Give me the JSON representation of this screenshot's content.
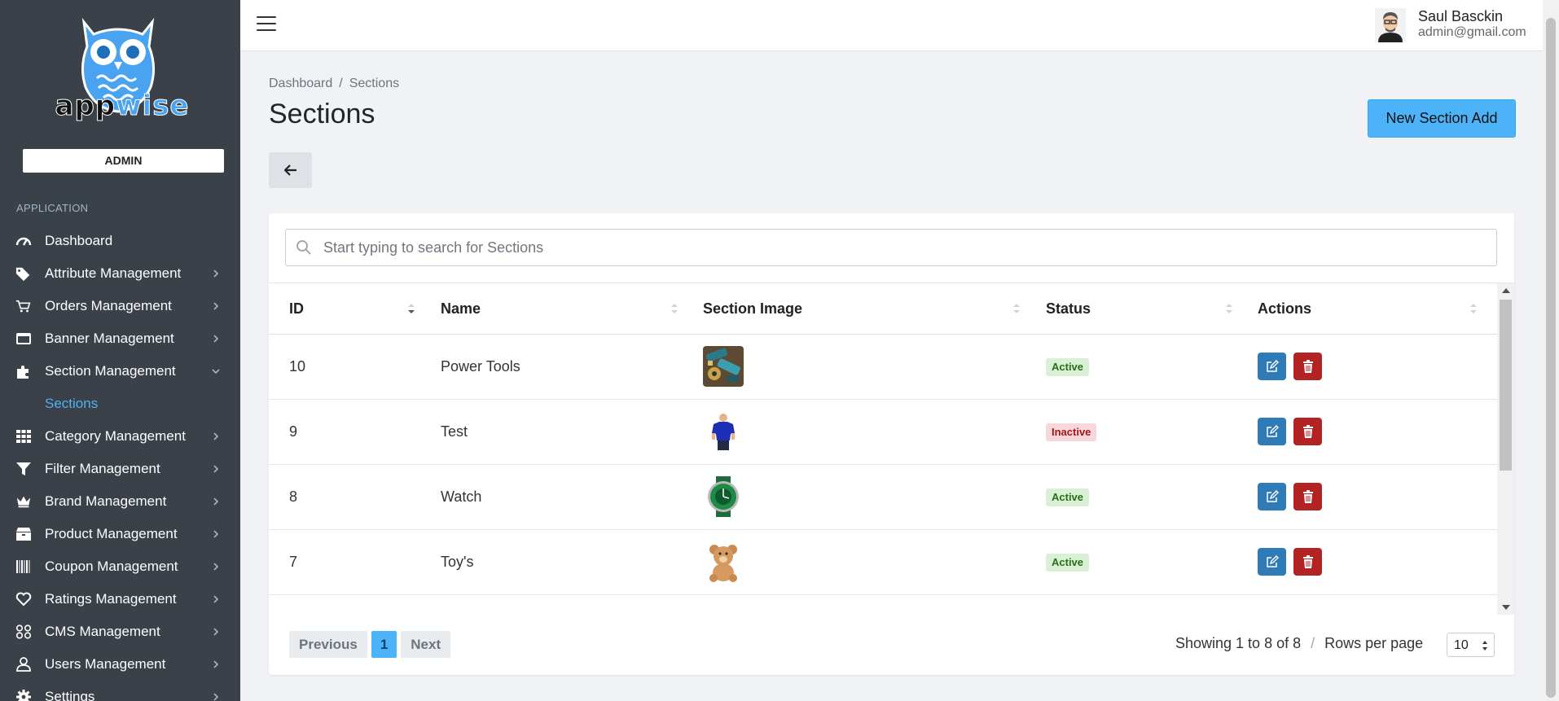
{
  "sidebar": {
    "logo": {
      "word_dark": "app",
      "word_blue": "wise"
    },
    "role": "ADMIN",
    "heading": "APPLICATION",
    "items": [
      {
        "label": "Dashboard",
        "icon": "dashboard-icon",
        "chevron": false
      },
      {
        "label": "Attribute Management",
        "icon": "tags-icon",
        "chevron": true
      },
      {
        "label": "Orders Management",
        "icon": "cart-icon",
        "chevron": true
      },
      {
        "label": "Banner Management",
        "icon": "banner-icon",
        "chevron": true
      },
      {
        "label": "Section Management",
        "icon": "puzzle-icon",
        "chevron": true,
        "expanded": true
      },
      {
        "label": "Category Management",
        "icon": "grid-icon",
        "chevron": true
      },
      {
        "label": "Filter Management",
        "icon": "filter-icon",
        "chevron": true
      },
      {
        "label": "Brand Management",
        "icon": "crown-icon",
        "chevron": true
      },
      {
        "label": "Product Management",
        "icon": "box-icon",
        "chevron": true
      },
      {
        "label": "Coupon Management",
        "icon": "barcode-icon",
        "chevron": true
      },
      {
        "label": "Ratings Management",
        "icon": "heart-icon",
        "chevron": true
      },
      {
        "label": "CMS Management",
        "icon": "cms-icon",
        "chevron": true
      },
      {
        "label": "Users Management",
        "icon": "user-icon",
        "chevron": true
      },
      {
        "label": "Settings",
        "icon": "gear-icon",
        "chevron": true
      }
    ],
    "sub_item": "Sections"
  },
  "topbar": {
    "user_name": "Saul Basckin",
    "user_email": "admin@gmail.com"
  },
  "breadcrumb": {
    "root": "Dashboard",
    "separator": "/",
    "current": "Sections"
  },
  "page": {
    "title": "Sections",
    "new_button": "New Section Add"
  },
  "search": {
    "placeholder": "Start typing to search for Sections"
  },
  "table": {
    "columns": [
      "ID",
      "Name",
      "Section Image",
      "Status",
      "Actions"
    ],
    "rows": [
      {
        "id": "10",
        "name": "Power Tools",
        "image": "power-tools-image",
        "status": "Active"
      },
      {
        "id": "9",
        "name": "Test",
        "image": "tshirt-image",
        "status": "Inactive"
      },
      {
        "id": "8",
        "name": "Watch",
        "image": "watch-image",
        "status": "Active"
      },
      {
        "id": "7",
        "name": "Toy's",
        "image": "teddy-bear-image",
        "status": "Active"
      }
    ]
  },
  "pagination": {
    "previous": "Previous",
    "current_page": "1",
    "next": "Next",
    "showing": "Showing 1 to 8 of 8",
    "separator": "/",
    "rows_per_page_label": "Rows per page",
    "rows_per_page_value": "10"
  },
  "colors": {
    "sidebar_bg": "#3b4148",
    "accent": "#4db3f8",
    "edit_button": "#2f7bb8",
    "delete_button": "#b42323",
    "active_badge": "#d8f1d4",
    "inactive_badge": "#f8d7da"
  }
}
